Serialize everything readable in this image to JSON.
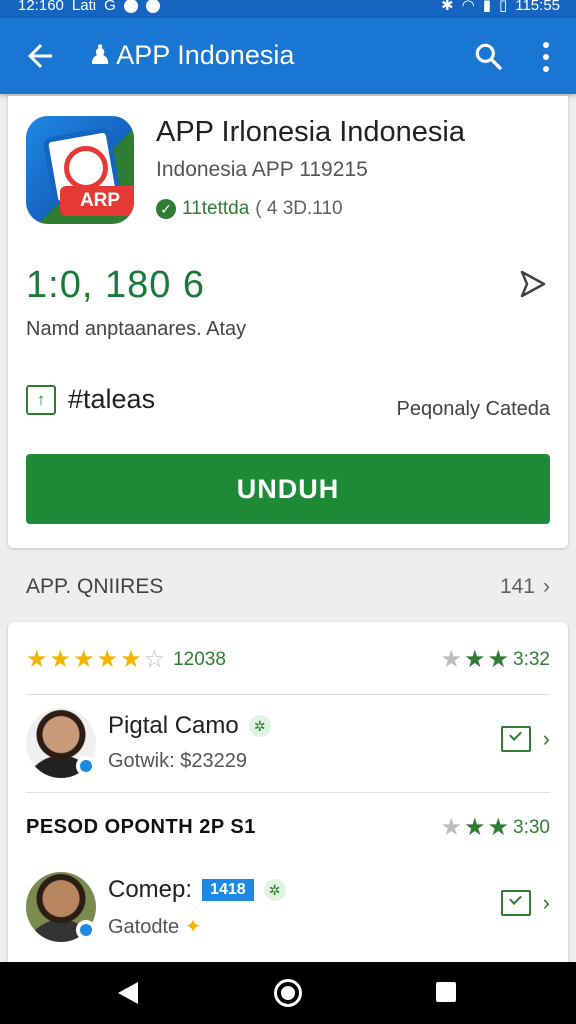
{
  "status": {
    "time_left": "12:160",
    "network": "Lati",
    "g": "G",
    "time_right": "115:55"
  },
  "appbar": {
    "title": "APP Indonesia",
    "title_icon": "chess-piece-icon"
  },
  "app": {
    "name": "APP Irlonesia Indonesia",
    "subtitle": "Indonesia  APP 119215",
    "developer": "11tettda",
    "version": "( 4  3D.110",
    "icon_badge": "ARP",
    "count": "1:0, 180  6",
    "description": "Namd anptaanares. Atay",
    "tag_label": "#taleas",
    "category": "Peqonaly Cateda",
    "install_label": "UNDUH"
  },
  "section": {
    "title": "APP. QNIIRES",
    "count": "141"
  },
  "ratings": {
    "stars_filled": 5,
    "stars_total": 6,
    "count": "12038",
    "right_value": "3:32"
  },
  "reviews": [
    {
      "name": "Pigtal Camo",
      "sub": "Gotwik: $23229",
      "chip": ""
    },
    {
      "name": "Comep:",
      "sub": "Gatodte",
      "chip": "1418"
    }
  ],
  "subsection": {
    "heading": "PESOD OPONTH 2P S1",
    "value": "3:30"
  },
  "colors": {
    "primary": "#1976d2",
    "install": "#1e8a37",
    "accent_green": "#2e7d32",
    "star_gold": "#f4b400"
  }
}
